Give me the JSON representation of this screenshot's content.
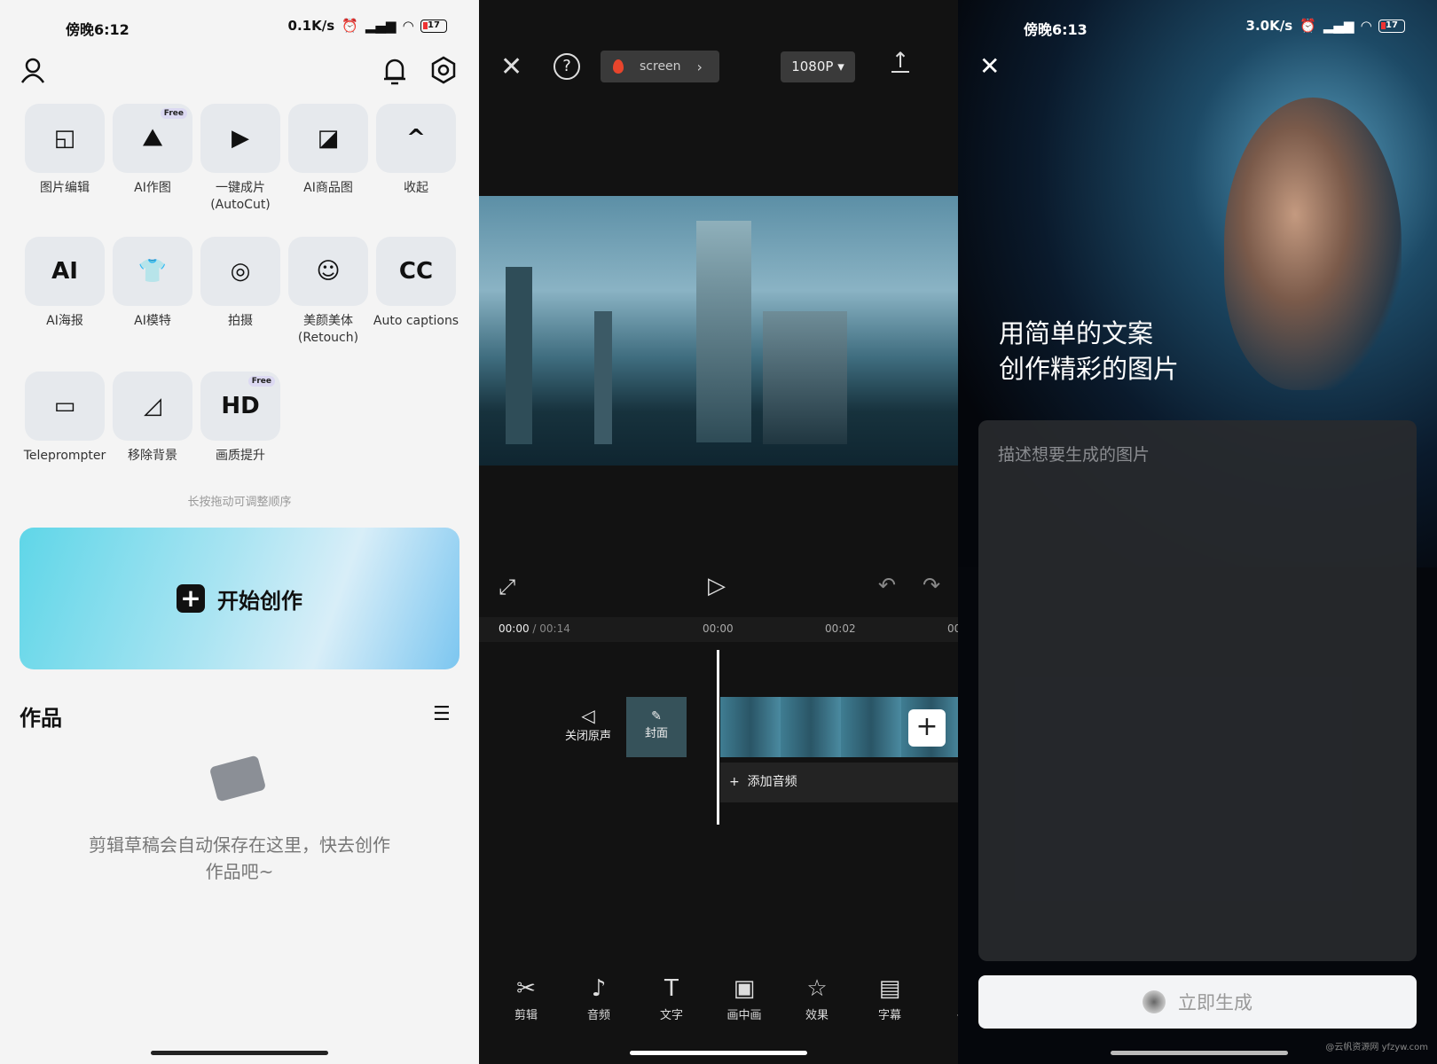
{
  "home": {
    "status": {
      "time": "傍晚6:12",
      "speed": "0.1K/s",
      "battery": "17"
    },
    "tools": [
      {
        "label": "图片编辑",
        "icon": "image-edit-icon",
        "glyph": "◱"
      },
      {
        "label": "AI作图",
        "icon": "ai-image-icon",
        "glyph": "⛰",
        "badge": "Free"
      },
      {
        "label": "一键成片\n(AutoCut)",
        "icon": "autocut-icon",
        "glyph": "▶"
      },
      {
        "label": "AI商品图",
        "icon": "ai-product-icon",
        "glyph": "◪"
      },
      {
        "label": "收起",
        "icon": "chevron-up-icon",
        "glyph": "^"
      },
      {
        "label": "AI海报",
        "icon": "ai-poster-icon",
        "glyph": "AI"
      },
      {
        "label": "AI模特",
        "icon": "ai-model-icon",
        "glyph": "👕"
      },
      {
        "label": "拍摄",
        "icon": "camera-icon",
        "glyph": "◎"
      },
      {
        "label": "美颜美体\n(Retouch)",
        "icon": "retouch-icon",
        "glyph": "☺"
      },
      {
        "label": "Auto captions",
        "icon": "captions-icon",
        "glyph": "CC"
      },
      {
        "label": "Teleprompter",
        "icon": "teleprompter-icon",
        "glyph": "▭"
      },
      {
        "label": "移除背景",
        "icon": "remove-bg-icon",
        "glyph": "◿"
      },
      {
        "label": "画质提升",
        "icon": "hd-icon",
        "glyph": "HD",
        "badge": "Free"
      }
    ],
    "hint": "长按拖动可调整顺序",
    "create_label": "开始创作",
    "works_title": "作品",
    "empty_text": "剪辑草稿会自动保存在这里，快去创作\n作品吧~"
  },
  "editor": {
    "project_name": "screen",
    "resolution": "1080P",
    "time_current": "00:00",
    "time_total": "/ 00:14",
    "ruler": [
      "00:00",
      "00:02",
      "00"
    ],
    "mute_label": "关闭原声",
    "cover_label": "封面",
    "add_audio": "添加音频",
    "toolbar": [
      {
        "label": "剪辑",
        "icon": "scissors-icon",
        "glyph": "✂"
      },
      {
        "label": "音频",
        "icon": "music-note-icon",
        "glyph": "♪"
      },
      {
        "label": "文字",
        "icon": "text-icon",
        "glyph": "T"
      },
      {
        "label": "画中画",
        "icon": "pip-icon",
        "glyph": "▣"
      },
      {
        "label": "效果",
        "icon": "effects-icon",
        "glyph": "☆"
      },
      {
        "label": "字幕",
        "icon": "subtitle-icon",
        "glyph": "▤"
      },
      {
        "label": "長",
        "icon": "more-icon",
        "glyph": "["
      }
    ]
  },
  "aigen": {
    "status": {
      "time": "傍晚6:13",
      "speed": "3.0K/s",
      "battery": "17"
    },
    "headline1": "用简单的文案",
    "headline2": "创作精彩的图片",
    "placeholder": "描述想要生成的图片",
    "generate_label": "立即生成",
    "watermark": "@云帆资源网 yfzyw.com"
  },
  "colors": {
    "accent_gradient_start": "#4fd3e6",
    "accent_gradient_end": "#a7d8f5",
    "record_red": "#e8452c"
  }
}
